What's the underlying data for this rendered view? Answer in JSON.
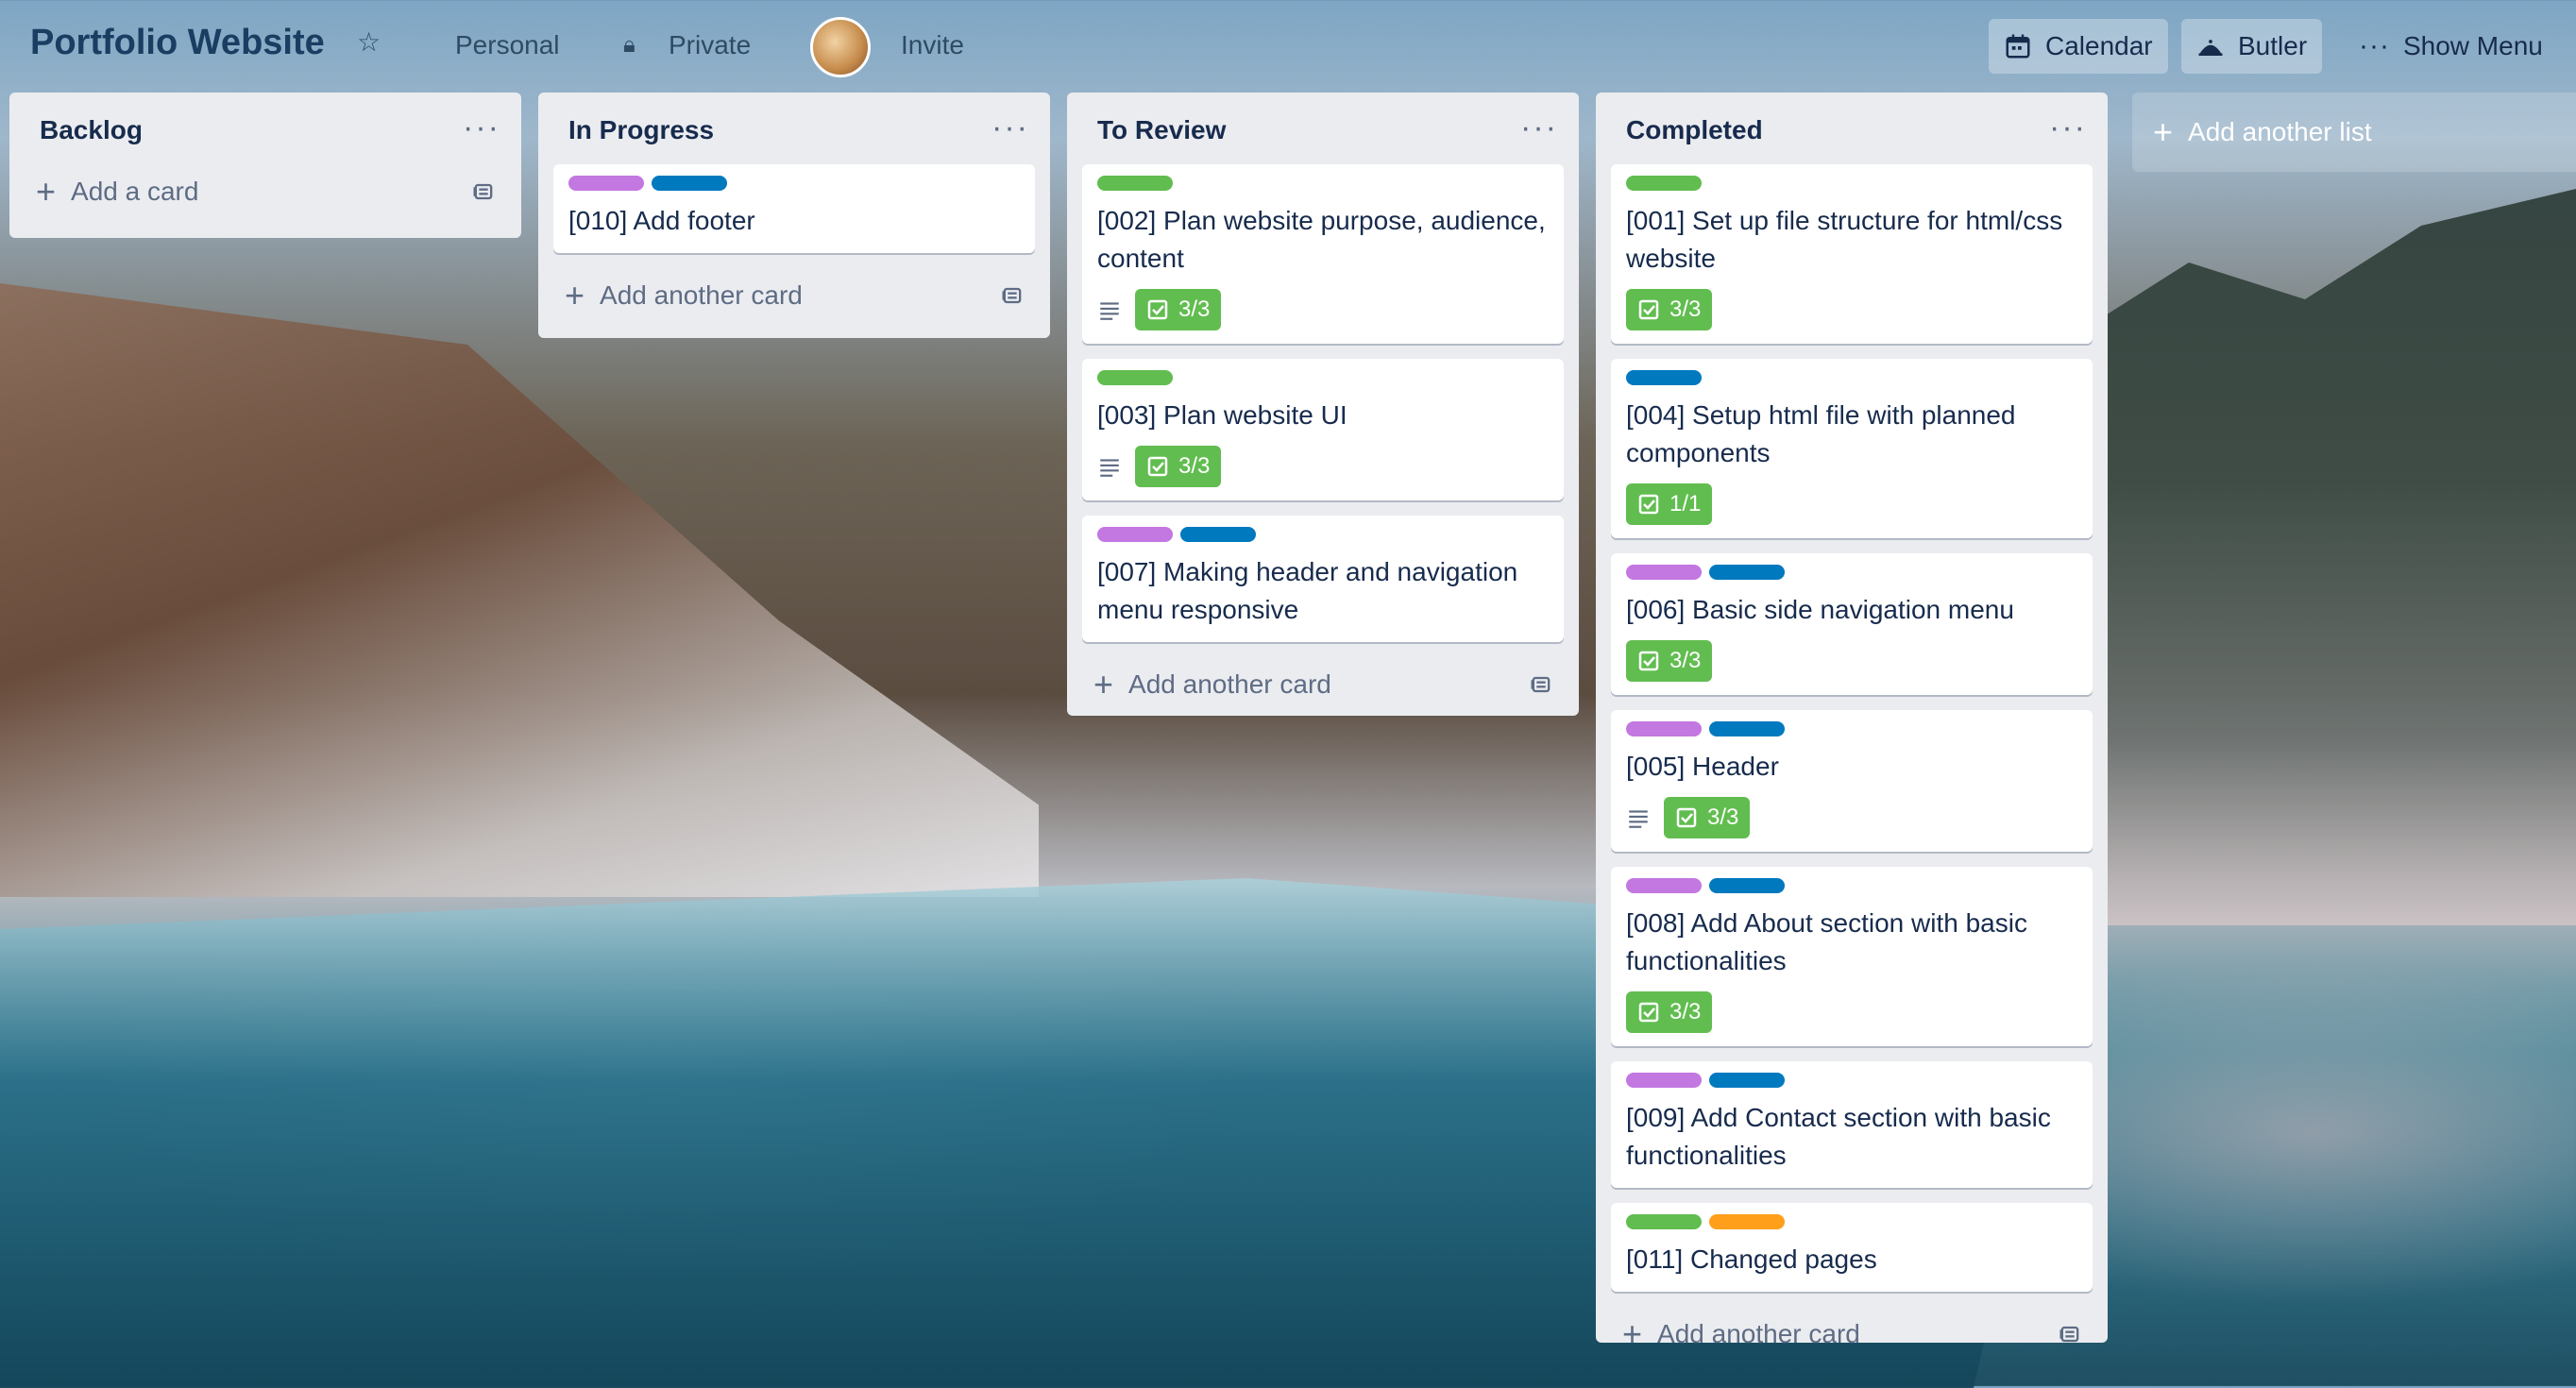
{
  "colors": {
    "label_green": "#61bd4f",
    "label_purple": "#c377e0",
    "label_blue": "#0079bf",
    "label_orange": "#ff9f1a",
    "checklist_complete": "#61bd4f"
  },
  "header": {
    "board_title": "Portfolio Website",
    "star_icon": "star-icon",
    "team": "Personal",
    "visibility": "Private",
    "visibility_icon": "lock-icon",
    "invite": "Invite",
    "calendar": "Calendar",
    "butler": "Butler",
    "show_menu": "Show Menu"
  },
  "lists": [
    {
      "title": "Backlog",
      "cards": [],
      "add_label": "Add a card"
    },
    {
      "title": "In Progress",
      "cards": [
        {
          "labels": [
            "purple",
            "blue"
          ],
          "title": "[010] Add footer",
          "description": false,
          "checklist": ""
        }
      ],
      "add_label": "Add another card"
    },
    {
      "title": "To Review",
      "cards": [
        {
          "labels": [
            "green"
          ],
          "title": "[002] Plan website purpose, audience, content",
          "description": true,
          "checklist": "3/3"
        },
        {
          "labels": [
            "green"
          ],
          "title": "[003] Plan website UI",
          "description": true,
          "checklist": "3/3"
        },
        {
          "labels": [
            "purple",
            "blue"
          ],
          "title": "[007] Making header and navigation menu responsive",
          "description": false,
          "checklist": ""
        }
      ],
      "add_label": "Add another card"
    },
    {
      "title": "Completed",
      "cards": [
        {
          "labels": [
            "green"
          ],
          "title": "[001] Set up file structure for html/css website",
          "description": false,
          "checklist": "3/3"
        },
        {
          "labels": [
            "blue"
          ],
          "title": "[004] Setup html file with planned components",
          "description": false,
          "checklist": "1/1"
        },
        {
          "labels": [
            "purple",
            "blue"
          ],
          "title": "[006] Basic side navigation menu",
          "description": false,
          "checklist": "3/3"
        },
        {
          "labels": [
            "purple",
            "blue"
          ],
          "title": "[005] Header",
          "description": true,
          "checklist": "3/3"
        },
        {
          "labels": [
            "purple",
            "blue"
          ],
          "title": "[008] Add About section with basic functionalities",
          "description": false,
          "checklist": "3/3"
        },
        {
          "labels": [
            "purple",
            "blue"
          ],
          "title": "[009] Add Contact section with basic functionalities",
          "description": false,
          "checklist": ""
        },
        {
          "labels": [
            "green",
            "orange"
          ],
          "title": "[011] Changed pages",
          "description": false,
          "checklist": ""
        }
      ],
      "add_label": "Add another card"
    }
  ],
  "add_list_label": "Add another list"
}
